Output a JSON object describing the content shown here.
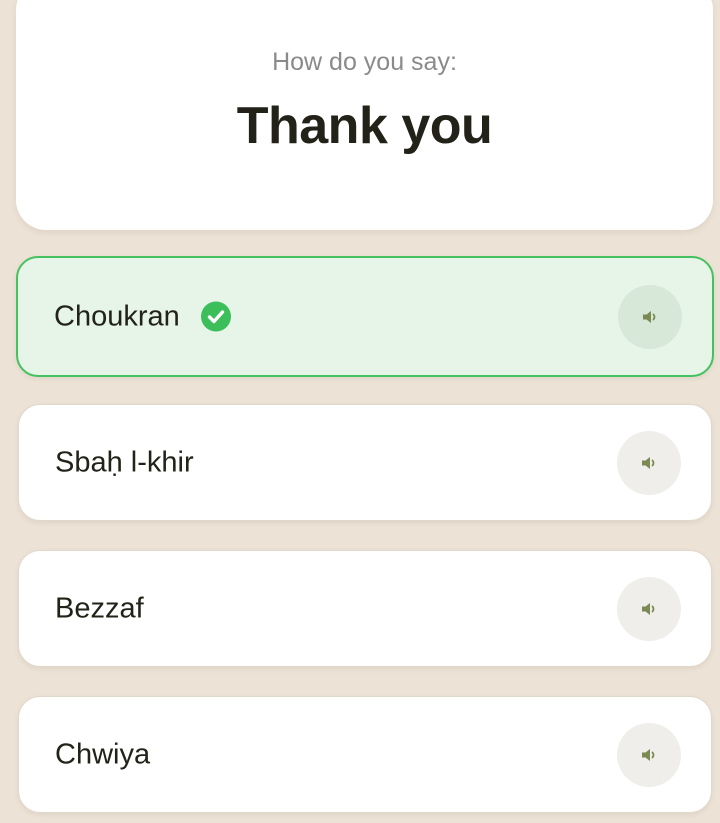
{
  "question": {
    "prompt": "How do you say:",
    "phrase": "Thank you"
  },
  "options": [
    {
      "label": "Choukran",
      "state": "correct",
      "audio_icon": "speaker-icon",
      "status_icon": "check-circle-icon"
    },
    {
      "label": "Sbaḥ l-khir",
      "state": "default",
      "audio_icon": "speaker-icon"
    },
    {
      "label": "Bezzaf",
      "state": "default",
      "audio_icon": "speaker-icon"
    },
    {
      "label": "Chwiya",
      "state": "default",
      "audio_icon": "speaker-icon"
    }
  ],
  "colors": {
    "background": "#ece2d6",
    "card": "#ffffff",
    "correct_fill": "#e6f5e8",
    "correct_border": "#46c160",
    "check_green": "#3cbf5a",
    "speaker_olive": "#7a8a52",
    "text_dark": "#222219",
    "text_muted": "#8a8a8a"
  }
}
